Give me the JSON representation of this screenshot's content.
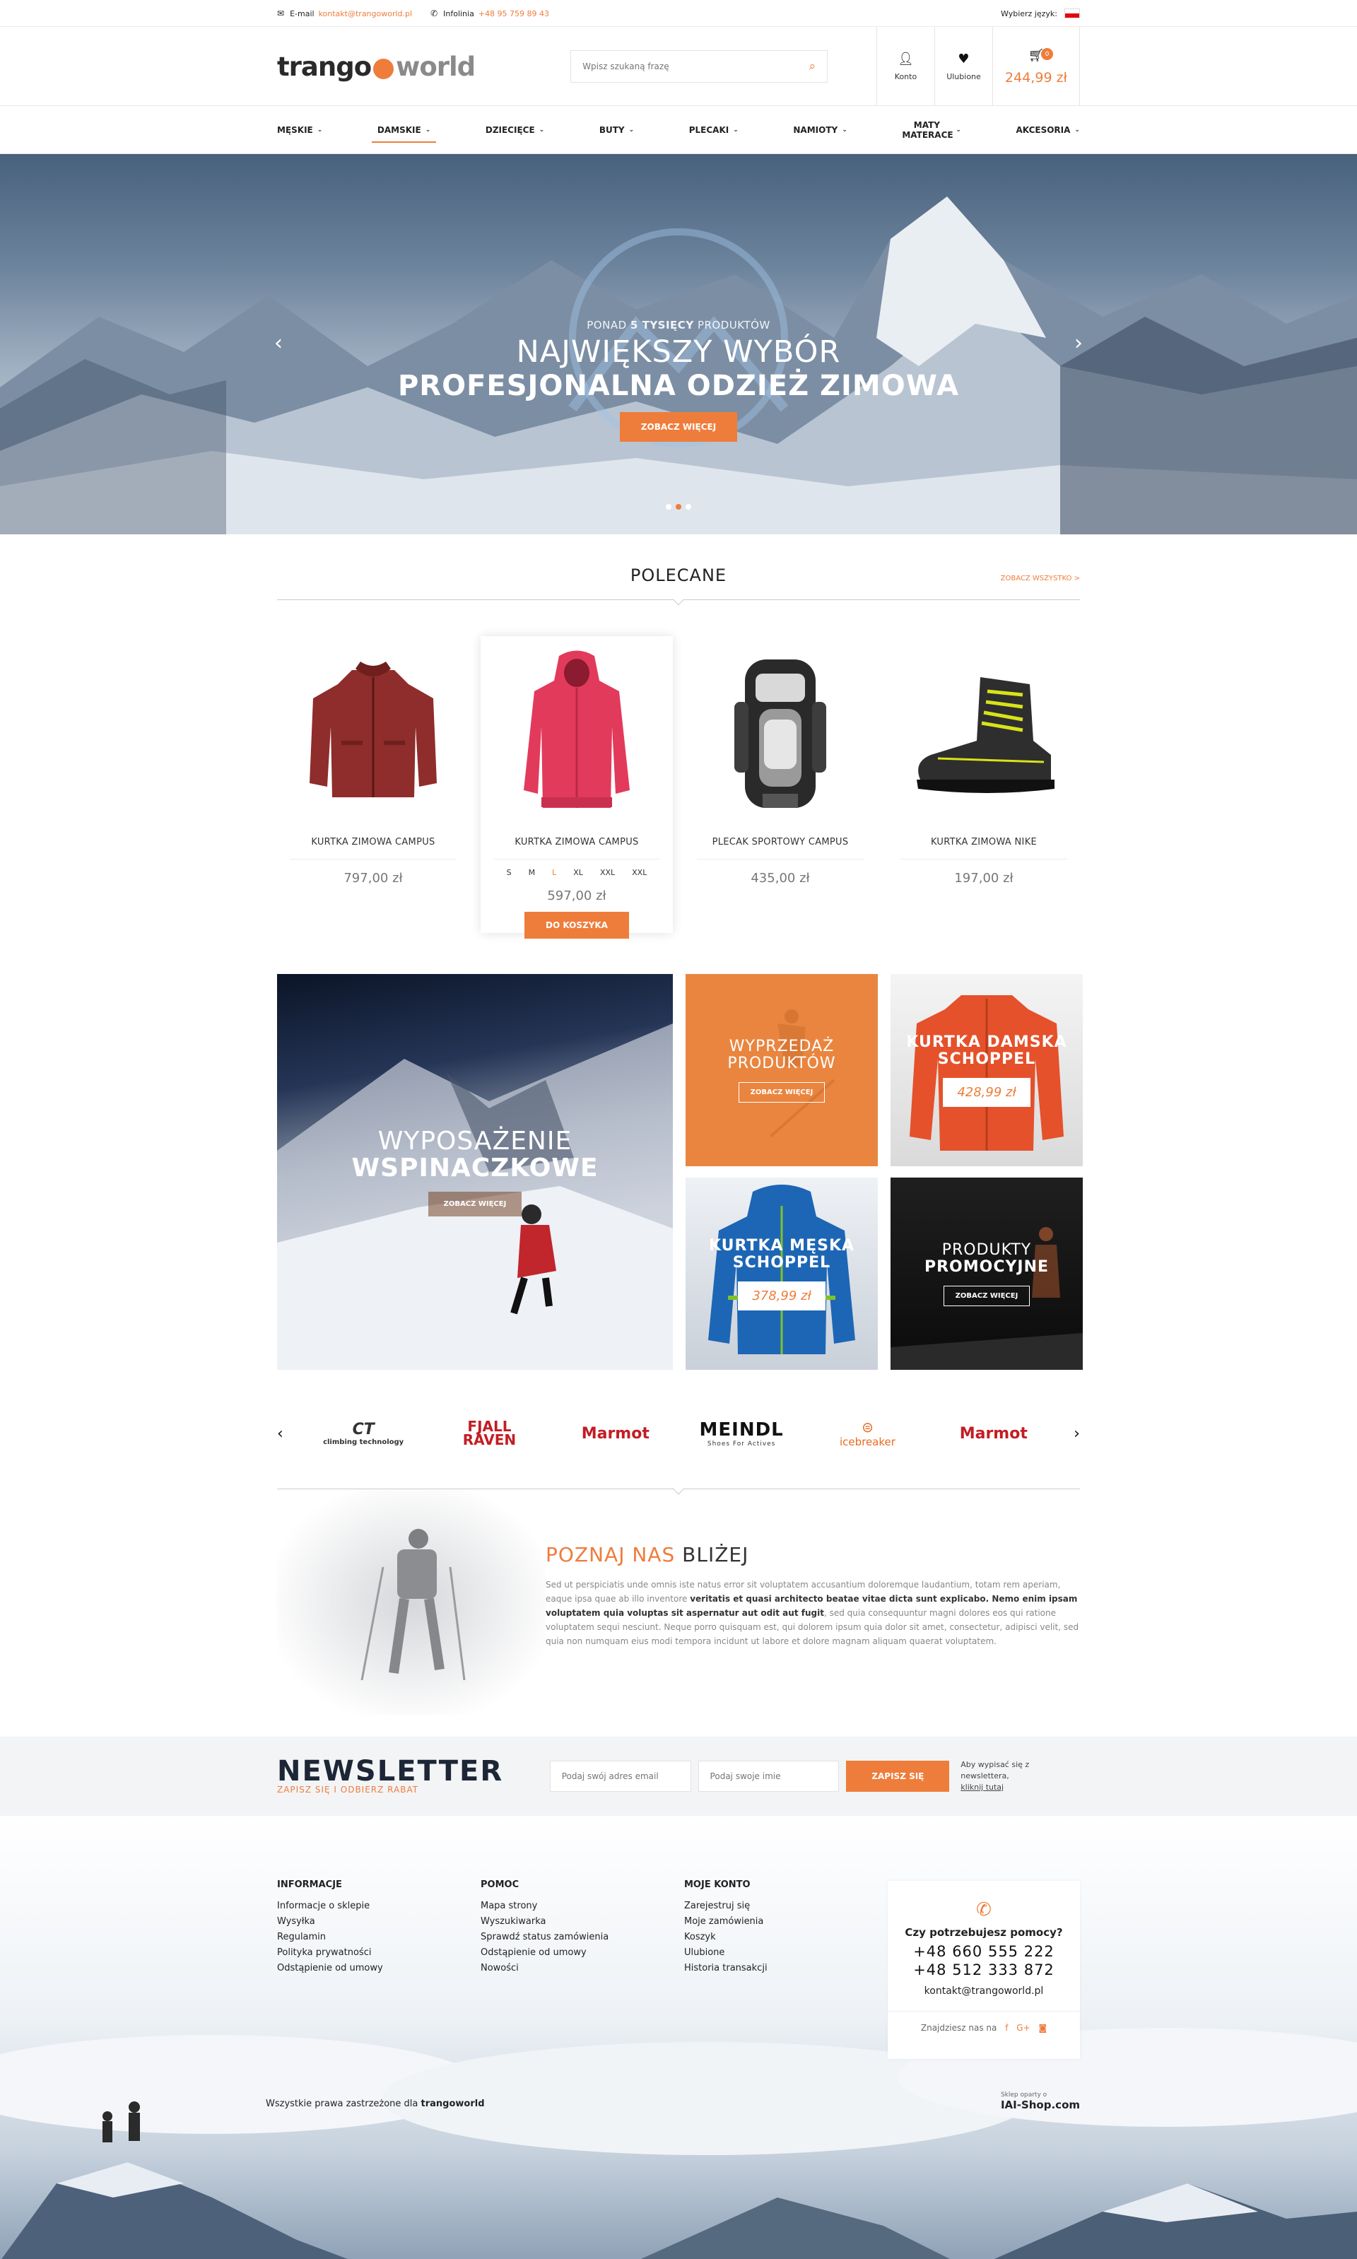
{
  "topbar": {
    "email_label": "E-mail",
    "email": "kontakt@trangoworld.pl",
    "hotline_label": "Infolinia",
    "hotline": "+48 95 759 89 43",
    "language_label": "Wybierz język:"
  },
  "header": {
    "logo_part1": "trango",
    "logo_part2": "world",
    "search_placeholder": "Wpisz szukaną frazę",
    "account_label": "Konto",
    "favorites_label": "Ulubione",
    "cart_count": "0",
    "cart_total": "244,99 zł"
  },
  "nav": {
    "items": [
      {
        "label": "MĘSKIE"
      },
      {
        "label": "DAMSKIE"
      },
      {
        "label": "DZIECIĘCE"
      },
      {
        "label": "BUTY"
      },
      {
        "label": "PLECAKI"
      },
      {
        "label": "NAMIOTY"
      },
      {
        "label": "MATY MATERACE"
      },
      {
        "label": "AKCESORIA"
      }
    ],
    "active": "DAMSKIE"
  },
  "hero": {
    "small_pre": "PONAD",
    "small_bold": "5 TYSIĘCY",
    "small_post": "PRODUKTÓW",
    "line1": "NAJWIĘKSZY WYBÓR",
    "line2": "PROFESJONALNA ODZIEŻ ZIMOWA",
    "button": "ZOBACZ WIĘCEJ",
    "slides": 3,
    "active_slide": 2
  },
  "recommended": {
    "title": "POLECANE",
    "see_all": "ZOBACZ WSZYSTKO >",
    "products": [
      {
        "name": "KURTKA ZIMOWA CAMPUS",
        "price": "797,00 zł",
        "image": "red-jacket"
      },
      {
        "name": "KURTKA ZIMOWA CAMPUS",
        "price": "597,00 zł",
        "image": "pink-jacket",
        "sizes": [
          "S",
          "M",
          "L",
          "XL",
          "XXL",
          "XXL"
        ],
        "selected_size": "L",
        "button": "DO KOSZYKA"
      },
      {
        "name": "PLECAK SPORTOWY CAMPUS",
        "price": "435,00 zł",
        "image": "backpack"
      },
      {
        "name": "KURTKA ZIMOWA NIKE",
        "price": "197,00 zł",
        "image": "boot"
      }
    ]
  },
  "banners": {
    "climbing": {
      "line1": "WYPOSAŻENIE",
      "line2": "WSPINACZKOWE",
      "button": "ZOBACZ WIĘCEJ"
    },
    "sale": {
      "line1": "WYPRZEDAŻ",
      "line2": "PRODUKTÓW",
      "button": "ZOBACZ WIĘCEJ"
    },
    "womens_jacket": {
      "line1": "KURTKA DAMSKA",
      "line2": "SCHOPPEL",
      "price": "428,99 zł"
    },
    "mens_jacket": {
      "line1": "KURTKA MĘSKA",
      "line2": "SCHOPPEL",
      "price": "378,99 zł"
    },
    "promo": {
      "line1": "PRODUKTY",
      "line2": "PROMOCYJNE",
      "button": "ZOBACZ WIĘCEJ"
    }
  },
  "brands": [
    {
      "name": "CT climbing technology",
      "top": "CT",
      "bottom": "climbing technology"
    },
    {
      "name": "Fjällräven",
      "top": "FJALL",
      "bottom": "RAVEN"
    },
    {
      "name": "Marmot",
      "top": "Marmot",
      "bottom": ""
    },
    {
      "name": "Meindl",
      "top": "MEINDL",
      "bottom": "Shoes For Actives"
    },
    {
      "name": "icebreaker",
      "top": "icebreaker",
      "bottom": ""
    },
    {
      "name": "Marmot",
      "top": "Marmot",
      "bottom": ""
    }
  ],
  "about": {
    "title_orange": "POZNAJ NAS",
    "title_dark": "BLIŻEJ",
    "text_1": "Sed ut perspiciatis unde omnis iste natus error sit voluptatem accusantium doloremque laudantium, totam rem aperiam, eaque ipsa quae ab illo inventore",
    "text_bold": "veritatis et quasi architecto beatae vitae dicta sunt explicabo. Nemo enim ipsam voluptatem quia voluptas sit aspernatur aut odit aut fugit",
    "text_2": ", sed quia consequuntur magni dolores eos qui ratione voluptatem sequi nesciunt. Neque porro quisquam est, qui dolorem ipsum quia dolor sit amet, consectetur, adipisci velit, sed quia non numquam eius modi tempora incidunt ut labore et dolore magnam aliquam quaerat voluptatem."
  },
  "newsletter": {
    "title": "NEWSLETTER",
    "subtitle": "ZAPISZ SIĘ I ODBIERZ RABAT",
    "email_placeholder": "Podaj swój adres email",
    "name_placeholder": "Podaj swoje imie",
    "button": "ZAPISZ SIĘ",
    "info": "Aby wypisać się z newslettera,",
    "info_link": "kliknij tutaj"
  },
  "footer": {
    "columns": [
      {
        "title": "INFORMACJE",
        "links": [
          "Informacje o sklepie",
          "Wysyłka",
          "Regulamin",
          "Polityka prywatności",
          "Odstąpienie od umowy"
        ]
      },
      {
        "title": "POMOC",
        "links": [
          "Mapa strony",
          "Wyszukiwarka",
          "Sprawdź status zamówienia",
          "Odstąpienie od umowy",
          "Nowości"
        ]
      },
      {
        "title": "MOJE KONTO",
        "links": [
          "Zarejestruj się",
          "Moje zamówienia",
          "Koszyk",
          "Ulubione",
          "Historia transakcji"
        ]
      }
    ],
    "help": {
      "question": "Czy potrzebujesz pomocy?",
      "phone1": "+48 660 555 222",
      "phone2": "+48 512 333 872",
      "email": "kontakt@trangoworld.pl",
      "social_label": "Znajdziesz nas na"
    },
    "copyright_prefix": "Wszystkie prawa zastrzeżone dla",
    "copyright_brand": "trangoworld",
    "iai_small": "Sklep oparty o",
    "iai": "IAI-Shop.com"
  },
  "colors": {
    "accent": "#ee7d3b",
    "dark": "#1d2636"
  }
}
